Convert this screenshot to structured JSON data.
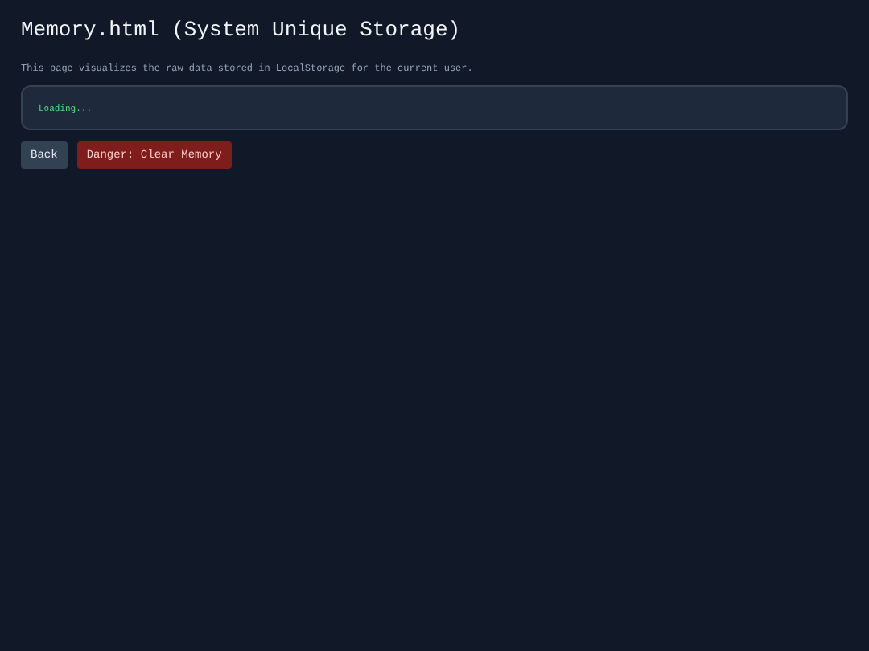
{
  "title": "Memory.html (System Unique Storage)",
  "description": "This page visualizes the raw data stored in LocalStorage for the current user.",
  "storage_panel": {
    "status": "Loading..."
  },
  "buttons": [
    {
      "label": "Back",
      "kind": "normal"
    },
    {
      "label": "Danger: Clear Memory",
      "kind": "danger"
    }
  ]
}
